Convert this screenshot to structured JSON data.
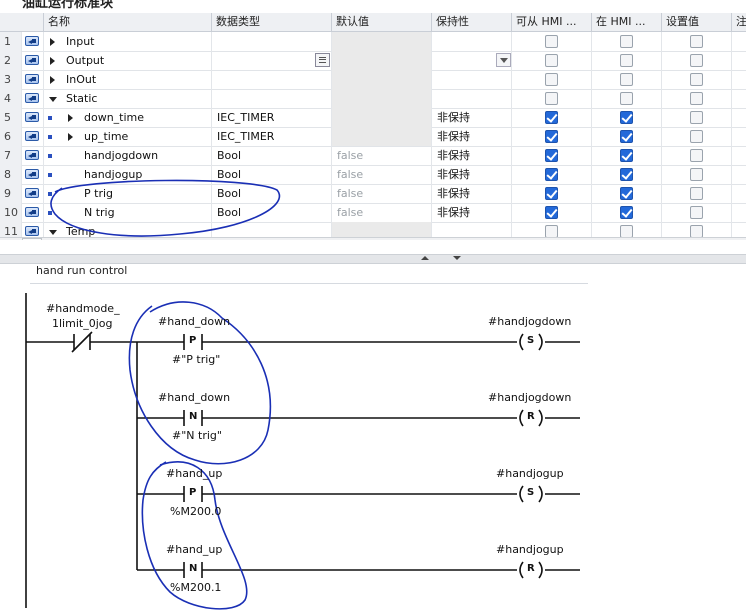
{
  "block_title": "油缸运行标准块",
  "columns": [
    "名称",
    "数据类型",
    "默认值",
    "保持性",
    "可从 HMI ...",
    "在 HMI ...",
    "设置值",
    "注"
  ],
  "rows": [
    {
      "num": "1",
      "indent": 0,
      "expander": "right",
      "name": "Input",
      "dtype": "",
      "default": "",
      "retain": "",
      "acc": false,
      "vis": false,
      "setp": false,
      "controls": false,
      "muted": true
    },
    {
      "num": "2",
      "indent": 0,
      "expander": "right",
      "name": "Output",
      "dtype": "",
      "default": "",
      "retain": "",
      "acc": false,
      "vis": false,
      "setp": false,
      "controls": true,
      "muted": true
    },
    {
      "num": "3",
      "indent": 0,
      "expander": "right",
      "name": "InOut",
      "dtype": "",
      "default": "",
      "retain": "",
      "acc": false,
      "vis": false,
      "setp": false,
      "controls": false,
      "muted": true
    },
    {
      "num": "4",
      "indent": 0,
      "expander": "down",
      "name": "Static",
      "dtype": "",
      "default": "",
      "retain": "",
      "acc": false,
      "vis": false,
      "setp": false,
      "controls": false,
      "muted": true
    },
    {
      "num": "5",
      "indent": 1,
      "expander": "right",
      "name": "down_time",
      "dtype": "IEC_TIMER",
      "default": "",
      "retain": "非保持",
      "acc": true,
      "vis": true,
      "setp": false,
      "controls": false,
      "muted": false
    },
    {
      "num": "6",
      "indent": 1,
      "expander": "right",
      "name": "up_time",
      "dtype": "IEC_TIMER",
      "default": "",
      "retain": "非保持",
      "acc": true,
      "vis": true,
      "setp": false,
      "controls": false,
      "muted": false
    },
    {
      "num": "7",
      "indent": 1,
      "expander": "",
      "name": "handjogdown",
      "dtype": "Bool",
      "default": "false",
      "retain": "非保持",
      "acc": true,
      "vis": true,
      "setp": false,
      "controls": false,
      "muted": false
    },
    {
      "num": "8",
      "indent": 1,
      "expander": "",
      "name": "handjogup",
      "dtype": "Bool",
      "default": "false",
      "retain": "非保持",
      "acc": true,
      "vis": true,
      "setp": false,
      "controls": false,
      "muted": false
    },
    {
      "num": "9",
      "indent": 1,
      "expander": "",
      "name": "P trig",
      "dtype": "Bool",
      "default": "false",
      "retain": "非保持",
      "acc": true,
      "vis": true,
      "setp": false,
      "controls": false,
      "muted": false
    },
    {
      "num": "10",
      "indent": 1,
      "expander": "",
      "name": "N trig",
      "dtype": "Bool",
      "default": "false",
      "retain": "非保持",
      "acc": true,
      "vis": true,
      "setp": false,
      "controls": false,
      "muted": false
    },
    {
      "num": "11",
      "indent": 0,
      "expander": "down",
      "name": "Temp",
      "dtype": "",
      "default": "",
      "retain": "",
      "acc": false,
      "vis": false,
      "setp": false,
      "controls": false,
      "muted": true
    }
  ],
  "scroll": {
    "left": "<",
    "grip": "|||"
  },
  "network": {
    "title": "hand run control",
    "contact_top": "#handmode_",
    "contact_bottom": "1limit_0jog",
    "rungs": [
      {
        "operand": "#hand_down",
        "type": "P",
        "memory": "#\"P trig\"",
        "coil_operand": "#handjogdown",
        "coil": "S"
      },
      {
        "operand": "#hand_down",
        "type": "N",
        "memory": "#\"N trig\"",
        "coil_operand": "#handjogdown",
        "coil": "R"
      },
      {
        "operand": "#hand_up",
        "type": "P",
        "memory": "%M200.0",
        "coil_operand": "#handjogup",
        "coil": "S"
      },
      {
        "operand": "#hand_up",
        "type": "N",
        "memory": "%M200.1",
        "coil_operand": "#handjogup",
        "coil": "R"
      }
    ]
  },
  "colors": {
    "annotation": "#1a2fb5",
    "checkbox_on": "#2369d9",
    "header_bg": "#eef0f3"
  }
}
